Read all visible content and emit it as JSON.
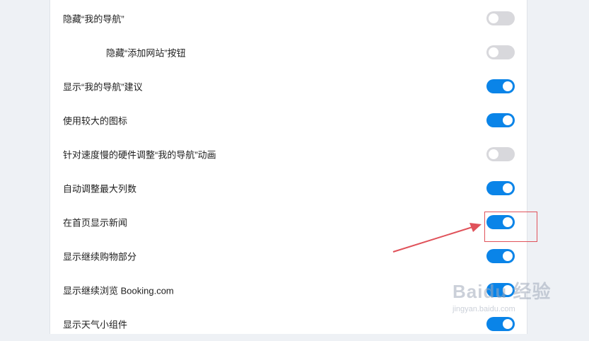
{
  "settings": {
    "items": [
      {
        "label": "隐藏“我的导航”",
        "on": false,
        "indent": false
      },
      {
        "label": "隐藏“添加网站”按钮",
        "on": false,
        "indent": true
      },
      {
        "label": "显示“我的导航”建议",
        "on": true,
        "indent": false
      },
      {
        "label": "使用较大的图标",
        "on": true,
        "indent": false
      },
      {
        "label": "针对速度慢的硬件调整“我的导航”动画",
        "on": false,
        "indent": false
      },
      {
        "label": "自动调整最大列数",
        "on": true,
        "indent": false
      },
      {
        "label": "在首页显示新闻",
        "on": true,
        "indent": false
      },
      {
        "label": "显示继续购物部分",
        "on": true,
        "indent": false
      },
      {
        "label": "显示继续浏览 Booking.com",
        "on": true,
        "indent": false
      },
      {
        "label": "显示天气小组件",
        "on": true,
        "indent": false
      }
    ]
  },
  "annotation": {
    "color": "#e0525a"
  },
  "watermark": {
    "main": "Baidu 经验",
    "sub": "jingyan.baidu.com"
  },
  "colors": {
    "toggle_on": "#0a84e8",
    "toggle_off": "#d8d8dc"
  }
}
